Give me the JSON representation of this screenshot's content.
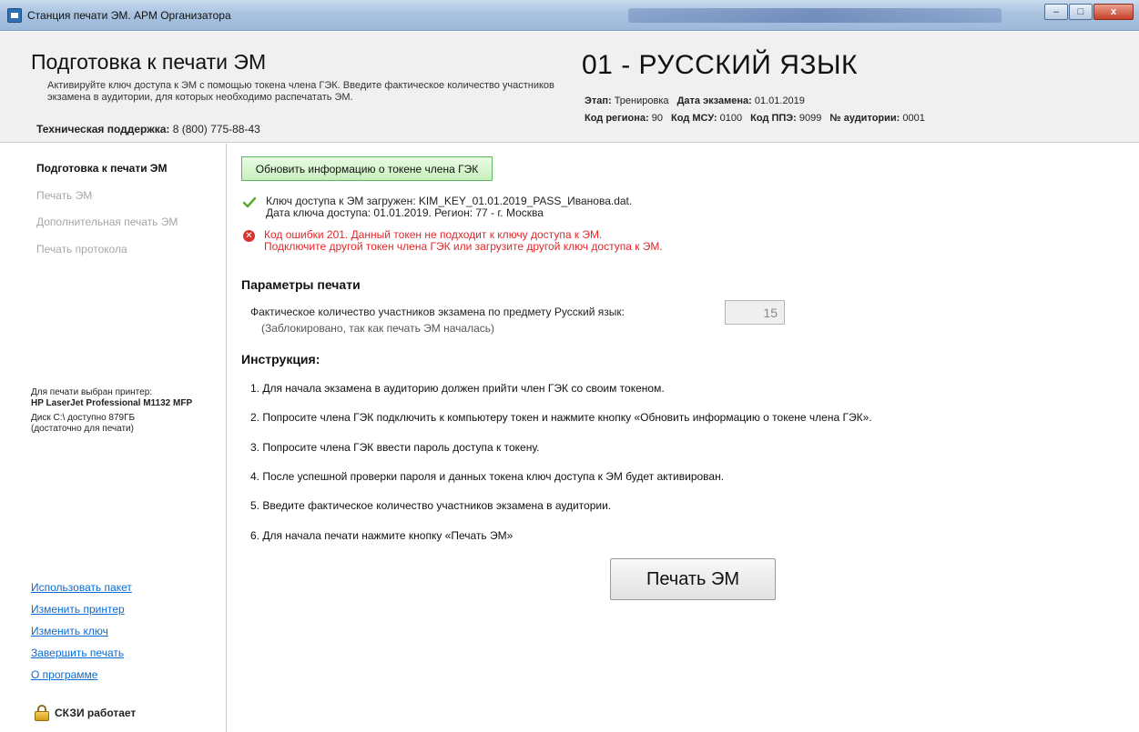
{
  "window": {
    "title": "Станция печати ЭМ. АРМ Организатора",
    "buttons": {
      "minimize": "–",
      "maximize": "□",
      "close": "x"
    }
  },
  "header": {
    "title": "Подготовка к печати ЭМ",
    "description": "Активируйте ключ доступа к ЭМ с помощью токена члена ГЭК. Введите фактическое количество участников экзамена в аудитории, для которых необходимо распечатать ЭМ.",
    "support_label": "Техническая поддержка:",
    "support_phone": "8 (800) 775-88-43",
    "subject": "01 - РУССКИЙ ЯЗЫК",
    "meta": {
      "stage_label": "Этап:",
      "stage_value": "Тренировка",
      "exam_date_label": "Дата экзамена:",
      "exam_date_value": "01.01.2019",
      "region_label": "Код региона:",
      "region_value": "90",
      "msu_label": "Код МСУ:",
      "msu_value": "0100",
      "ppe_label": "Код ППЭ:",
      "ppe_value": "9099",
      "room_label": "№ аудитории:",
      "room_value": "0001"
    }
  },
  "sidebar": {
    "nav": [
      {
        "label": "Подготовка к печати ЭМ",
        "active": true
      },
      {
        "label": "Печать ЭМ",
        "active": false
      },
      {
        "label": "Дополнительная печать ЭМ",
        "active": false
      },
      {
        "label": "Печать протокола",
        "active": false
      }
    ],
    "printer_label": "Для печати выбран принтер:",
    "printer_name": "HP LaserJet Professional M1132 MFP",
    "disk_line1": "Диск C:\\ доступно 879ГБ",
    "disk_line2": "(достаточно для печати)",
    "links": [
      "Использовать пакет",
      "Изменить принтер",
      "Изменить ключ",
      "Завершить печать",
      "О программе"
    ],
    "skzi_status": "СКЗИ работает"
  },
  "main": {
    "token_button": "Обновить информацию о токене члена ГЭК",
    "status_ok_line1": "Ключ доступа к ЭМ загружен: KIM_KEY_01.01.2019_PASS_Иванова.dat.",
    "status_ok_line2": "Дата ключа доступа: 01.01.2019. Регион: 77 - г. Москва",
    "status_err_line1": "Код ошибки 201. Данный токен не подходит к ключу доступа к ЭМ.",
    "status_err_line2": "Подключите другой токен члена ГЭК или загрузите другой ключ доступа к ЭМ.",
    "params_title": "Параметры печати",
    "participants_label": "Фактическое количество участников экзамена по предмету Русский язык:",
    "participants_note": "(Заблокировано, так как печать ЭМ началась)",
    "participants_value": "15",
    "instructions_title": "Инструкция:",
    "instructions": [
      "1. Для начала экзамена в аудиторию должен прийти член ГЭК со своим токеном.",
      "2. Попросите члена ГЭК подключить к компьютеру токен и нажмите кнопку «Обновить информацию о токене члена ГЭК».",
      "3. Попросите члена ГЭК ввести пароль доступа к токену.",
      "4. После успешной проверки пароля и данных токена ключ доступа к ЭМ будет активирован.",
      "5. Введите фактическое количество участников экзамена в аудитории.",
      "6. Для начала печати нажмите кнопку «Печать ЭМ»"
    ],
    "print_button": "Печать ЭМ"
  },
  "colors": {
    "error": "#e3262b",
    "link": "#0b6bd1",
    "token_button_border": "#5cb85c",
    "ok_check": "#5aa832"
  }
}
